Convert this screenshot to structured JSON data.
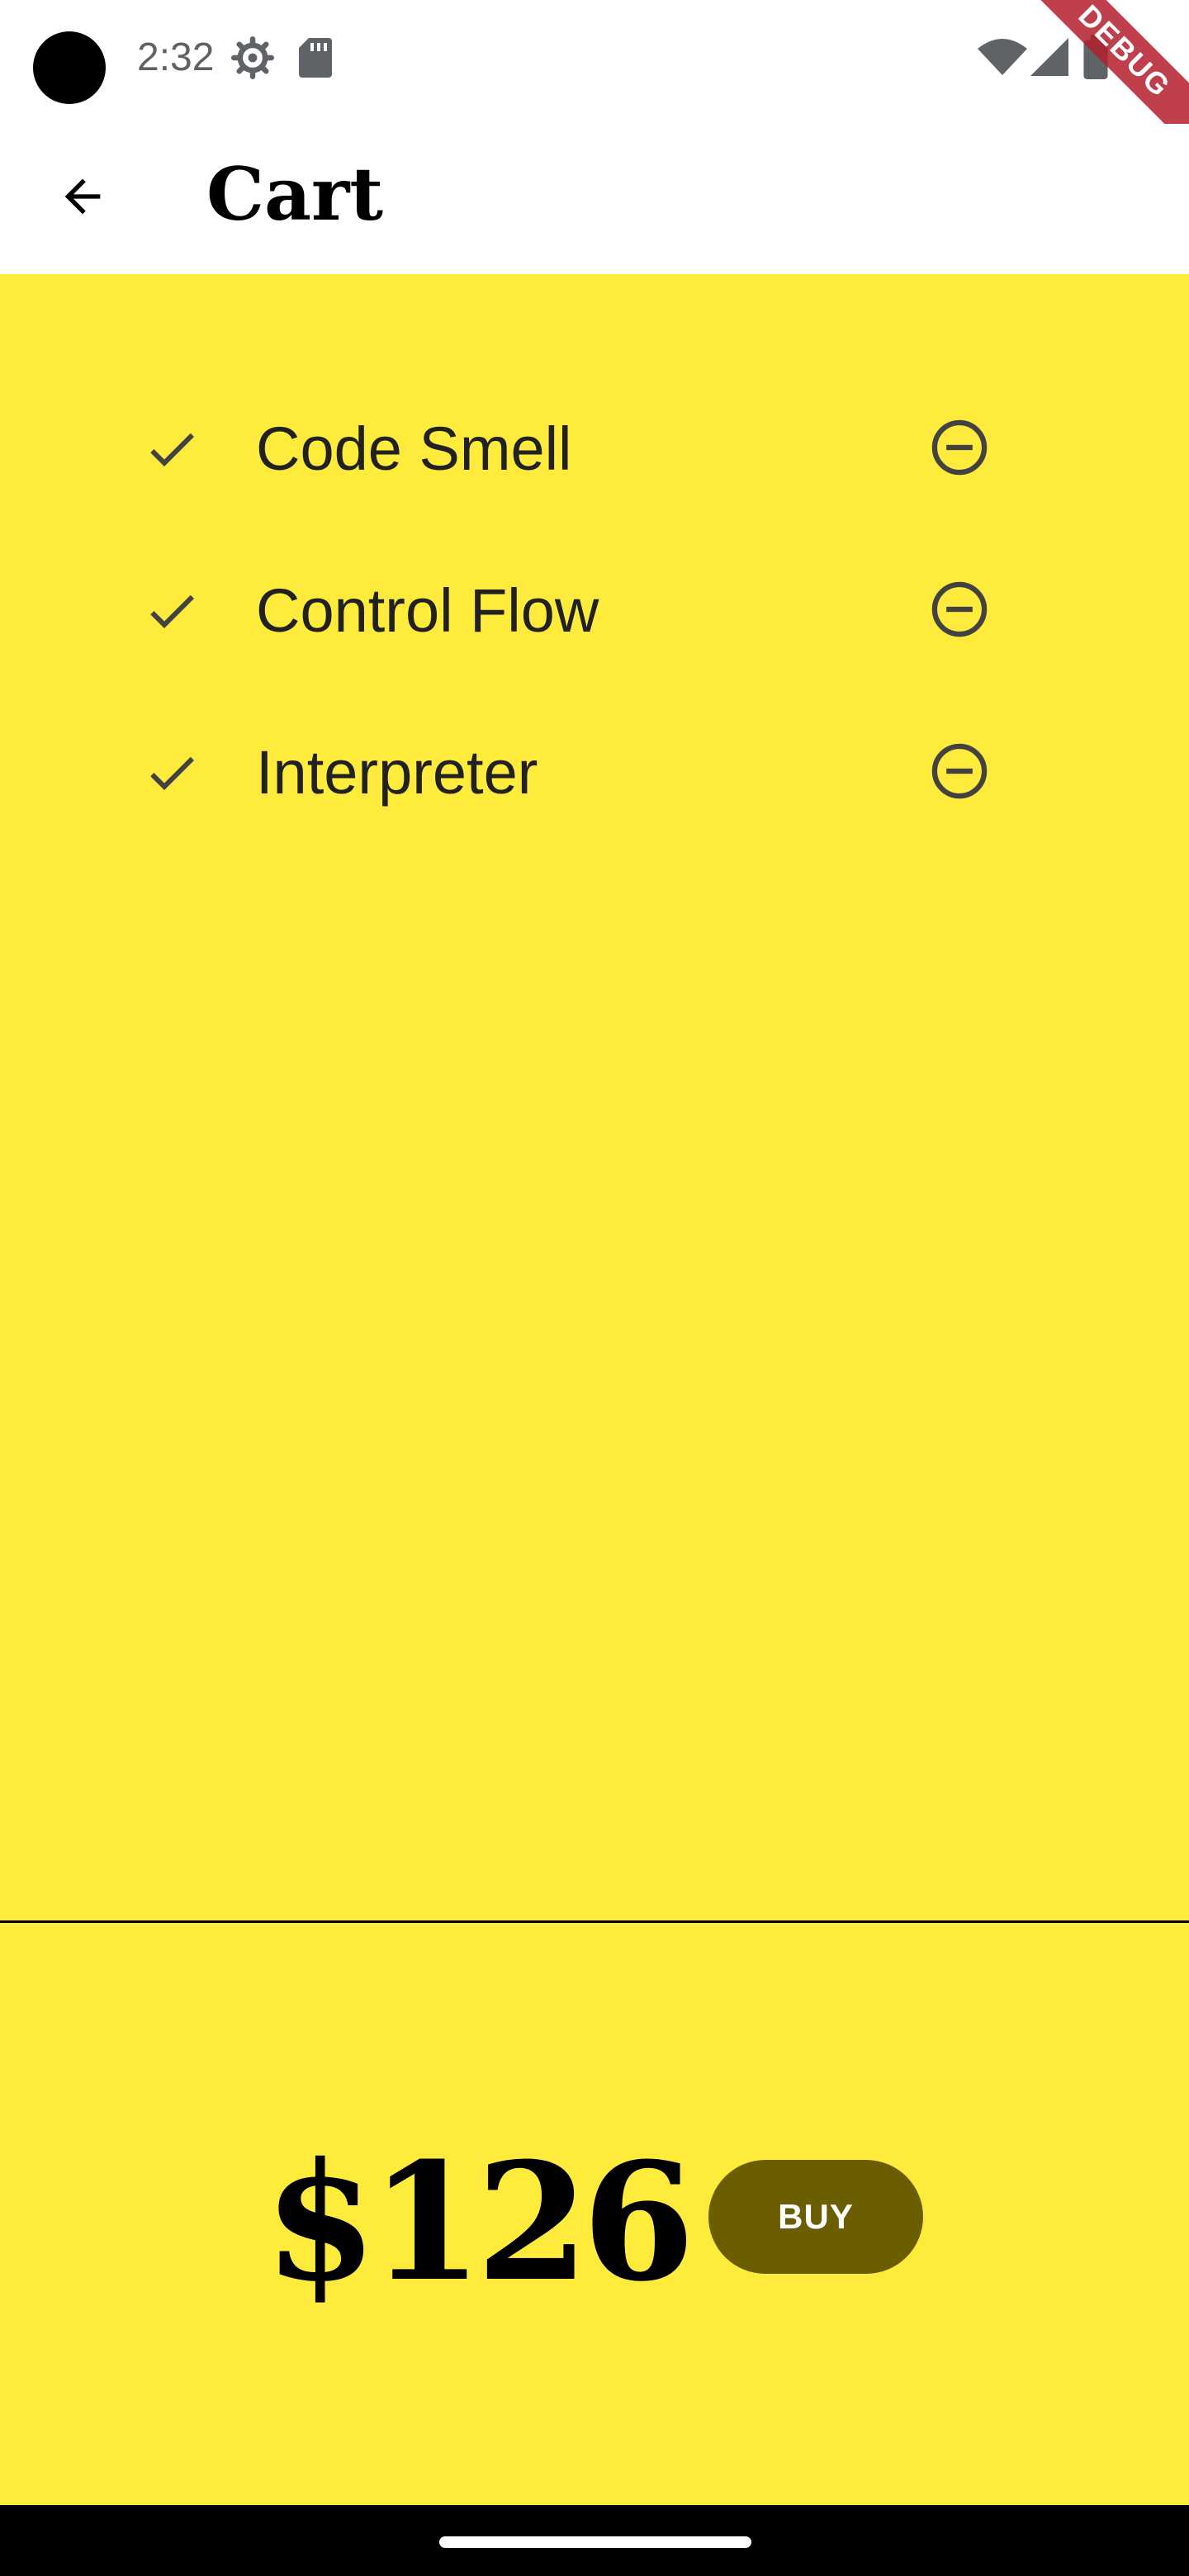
{
  "status_bar": {
    "time": "2:32",
    "icons": [
      "settings-icon",
      "sd-card-icon",
      "wifi-icon",
      "cellular-signal-icon",
      "battery-icon"
    ]
  },
  "debug_banner": "DEBUG",
  "app_bar": {
    "back_icon": "arrow-back-icon",
    "title": "Cart"
  },
  "cart": {
    "items": [
      {
        "name": "Code Smell",
        "check_icon": "check-icon",
        "remove_icon": "remove-circle-icon"
      },
      {
        "name": "Control Flow",
        "check_icon": "check-icon",
        "remove_icon": "remove-circle-icon"
      },
      {
        "name": "Interpreter",
        "check_icon": "check-icon",
        "remove_icon": "remove-circle-icon"
      }
    ],
    "total": "$126",
    "buy_label": "BUY"
  },
  "colors": {
    "panel_background": "#ffeb3b",
    "buy_button": "#6b5e00",
    "text": "#212121"
  }
}
